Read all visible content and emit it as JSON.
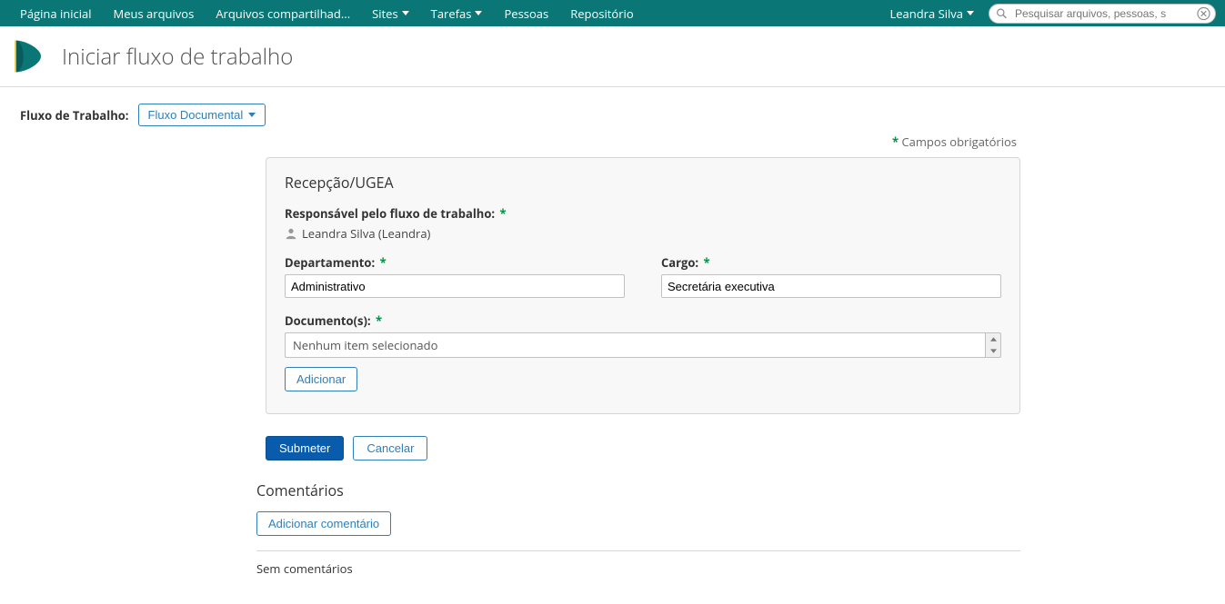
{
  "nav": {
    "items": [
      {
        "label": "Página inicial",
        "dropdown": false
      },
      {
        "label": "Meus arquivos",
        "dropdown": false
      },
      {
        "label": "Arquivos compartilhad...",
        "dropdown": false
      },
      {
        "label": "Sites",
        "dropdown": true
      },
      {
        "label": "Tarefas",
        "dropdown": true
      },
      {
        "label": "Pessoas",
        "dropdown": false
      },
      {
        "label": "Repositório",
        "dropdown": false
      }
    ],
    "user": "Leandra Silva",
    "search_placeholder": "Pesquisar arquivos, pessoas, s"
  },
  "header": {
    "title": "Iniciar fluxo de trabalho"
  },
  "workflow": {
    "label": "Fluxo de Trabalho:",
    "selected": "Fluxo Documental"
  },
  "required_text": "Campos obrigatórios",
  "panel": {
    "title": "Recepção/UGEA",
    "responsavel_label": "Responsável pelo fluxo de trabalho:",
    "responsavel_value": "Leandra Silva (Leandra)",
    "departamento_label": "Departamento:",
    "departamento_value": "Administrativo",
    "cargo_label": "Cargo:",
    "cargo_value": "Secretária executiva",
    "documentos_label": "Documento(s):",
    "documentos_empty": "Nenhum item selecionado",
    "adicionar": "Adicionar"
  },
  "actions": {
    "submit": "Submeter",
    "cancel": "Cancelar"
  },
  "comments": {
    "title": "Comentários",
    "add": "Adicionar comentário",
    "empty": "Sem comentários"
  }
}
